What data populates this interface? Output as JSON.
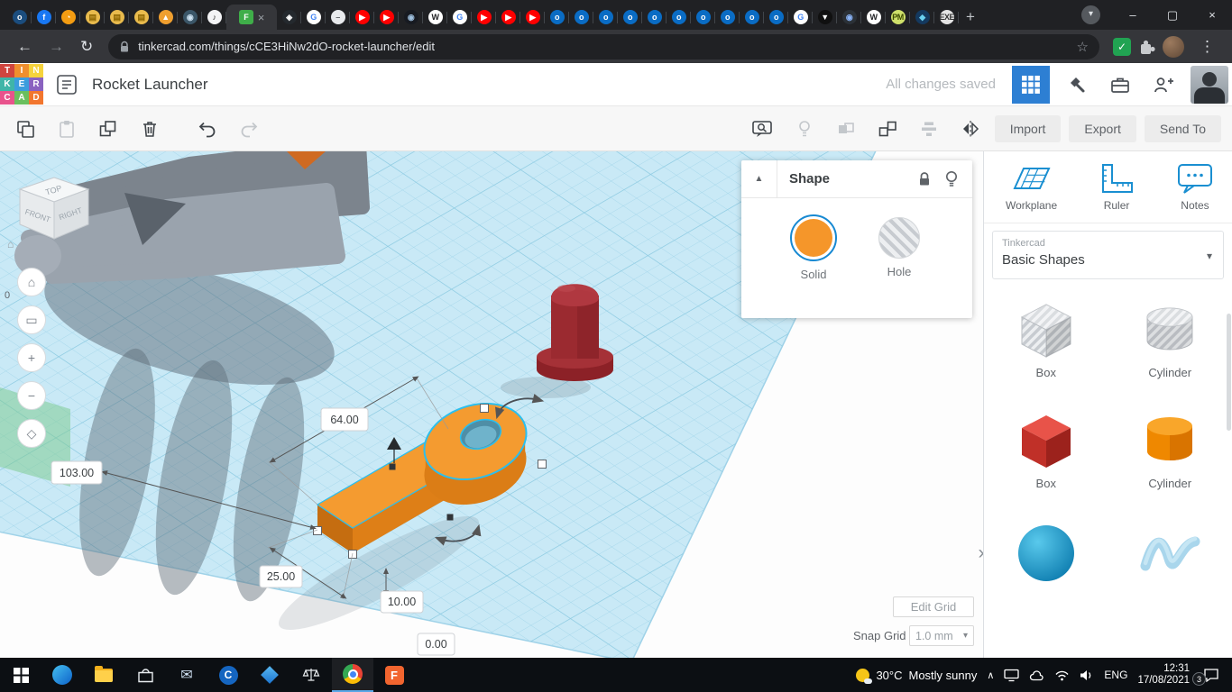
{
  "icons": {
    "close": "×",
    "minimize": "–",
    "maximize": "▢",
    "back": "←",
    "forward": "→",
    "reload": "↻",
    "star": "☆",
    "kebab": "⋮",
    "new_tab": "+",
    "profile_caret": "▾",
    "tray_chevron": "∧",
    "panel_collapse": "▲",
    "canvas_collapse": "›",
    "dropdown_caret": "▾",
    "home": "⌂",
    "fit_view": "▭",
    "zoom_in": "+",
    "zoom_out": "−",
    "ortho": "◇",
    "ext_check": "✓",
    "mail": "✉"
  },
  "browser": {
    "url": "tinkercad.com/things/cCE3HiNw2dO-rocket-launcher/edit",
    "tabs": [
      {
        "bg": "#1b4d7e",
        "fg": "#ffffff",
        "glyph": "o"
      },
      {
        "bg": "#1877f2",
        "fg": "#ffffff",
        "glyph": "f"
      },
      {
        "bg": "#f39c12",
        "fg": "#ffffff",
        "glyph": "◔"
      },
      {
        "bg": "#e9bb4d",
        "fg": "#8a6400",
        "glyph": "▤"
      },
      {
        "bg": "#e9bb4d",
        "fg": "#8a6400",
        "glyph": "▤"
      },
      {
        "bg": "#e9bb4d",
        "fg": "#8a6400",
        "glyph": "▤"
      },
      {
        "bg": "#ef9f2f",
        "fg": "#ffffff",
        "glyph": "▲"
      },
      {
        "bg": "#3b5668",
        "fg": "#cfe3f2",
        "glyph": "◉"
      },
      {
        "bg": "#f4f4f6",
        "fg": "#333333",
        "glyph": "♪"
      },
      {
        "bg": "#3fae49",
        "fg": "#ffffff",
        "glyph": "F",
        "active": true
      },
      {
        "bg": "#24292e",
        "fg": "#ffffff",
        "glyph": "◈"
      },
      {
        "bg": "#ffffff",
        "fg": "#4285f4",
        "glyph": "G"
      },
      {
        "bg": "#e8eaed",
        "fg": "#5f6368",
        "glyph": "–"
      },
      {
        "bg": "#ff0000",
        "fg": "#ffffff",
        "glyph": "▶"
      },
      {
        "bg": "#ff0000",
        "fg": "#ffffff",
        "glyph": "▶"
      },
      {
        "bg": "#171a21",
        "fg": "#9fc1e0",
        "glyph": "◉"
      },
      {
        "bg": "#ffffff",
        "fg": "#202124",
        "glyph": "W"
      },
      {
        "bg": "#ffffff",
        "fg": "#4285f4",
        "glyph": "G"
      },
      {
        "bg": "#ff0000",
        "fg": "#ffffff",
        "glyph": "▶"
      },
      {
        "bg": "#ff0000",
        "fg": "#ffffff",
        "glyph": "▶"
      },
      {
        "bg": "#ff0000",
        "fg": "#ffffff",
        "glyph": "▶"
      },
      {
        "bg": "#0a6cc4",
        "fg": "#ffffff",
        "glyph": "o"
      },
      {
        "bg": "#0a6cc4",
        "fg": "#ffffff",
        "glyph": "o"
      },
      {
        "bg": "#0a6cc4",
        "fg": "#ffffff",
        "glyph": "o"
      },
      {
        "bg": "#0a6cc4",
        "fg": "#ffffff",
        "glyph": "o"
      },
      {
        "bg": "#0a6cc4",
        "fg": "#ffffff",
        "glyph": "o"
      },
      {
        "bg": "#0a6cc4",
        "fg": "#ffffff",
        "glyph": "o"
      },
      {
        "bg": "#0a6cc4",
        "fg": "#ffffff",
        "glyph": "o"
      },
      {
        "bg": "#0a6cc4",
        "fg": "#ffffff",
        "glyph": "o"
      },
      {
        "bg": "#0a6cc4",
        "fg": "#ffffff",
        "glyph": "o"
      },
      {
        "bg": "#0a6cc4",
        "fg": "#ffffff",
        "glyph": "o"
      },
      {
        "bg": "#ffffff",
        "fg": "#4285f4",
        "glyph": "G"
      },
      {
        "bg": "#101010",
        "fg": "#ffffff",
        "glyph": "▼"
      },
      {
        "bg": "#2b3137",
        "fg": "#8ab4f8",
        "glyph": "◉"
      },
      {
        "bg": "#ffffff",
        "fg": "#202124",
        "glyph": "W"
      },
      {
        "bg": "#cfe06a",
        "fg": "#3c4a00",
        "glyph": "PM"
      },
      {
        "bg": "#14395f",
        "fg": "#6ad1f0",
        "glyph": "◆"
      },
      {
        "bg": "#e4e4e4",
        "fg": "#333333",
        "glyph": "EXE"
      }
    ]
  },
  "header": {
    "logo": [
      {
        "ch": "T",
        "bg": "#d0453e"
      },
      {
        "ch": "I",
        "bg": "#ef8f2e"
      },
      {
        "ch": "N",
        "bg": "#f6d33c"
      },
      {
        "ch": "K",
        "bg": "#3fb5a8"
      },
      {
        "ch": "E",
        "bg": "#3b9ddd"
      },
      {
        "ch": "R",
        "bg": "#8a62c0"
      },
      {
        "ch": "C",
        "bg": "#e8538c"
      },
      {
        "ch": "A",
        "bg": "#6abf5e"
      },
      {
        "ch": "D",
        "bg": "#f2762e"
      }
    ],
    "title": "Rocket Launcher",
    "saved_status": "All changes saved"
  },
  "toolbar": {
    "import": "Import",
    "export": "Export",
    "send_to": "Send To"
  },
  "viewport": {
    "viewcube": {
      "top": "TOP",
      "front": "FRONT",
      "right": "RIGHT"
    },
    "origin_label": "0",
    "dims": {
      "d64": "64.00",
      "d103": "103.00",
      "d25": "25.00",
      "d10": "10.00",
      "d0": "0.00"
    },
    "edit_grid": "Edit Grid",
    "snap_grid_label": "Snap Grid",
    "snap_grid_value": "1.0 mm"
  },
  "shape_panel": {
    "title": "Shape",
    "solid_label": "Solid",
    "hole_label": "Hole"
  },
  "sidebar": {
    "tools": [
      {
        "label": "Workplane"
      },
      {
        "label": "Ruler"
      },
      {
        "label": "Notes"
      }
    ],
    "library_group": "Tinkercad",
    "library_name": "Basic Shapes",
    "shapes": [
      {
        "label": "Box"
      },
      {
        "label": "Cylinder"
      },
      {
        "label": "Box"
      },
      {
        "label": "Cylinder"
      },
      {
        "label": ""
      },
      {
        "label": ""
      }
    ]
  },
  "taskbar": {
    "temp": "30°C",
    "weather": "Mostly sunny",
    "lang": "ENG",
    "time": "12:31",
    "date": "17/08/2021",
    "badge": "3",
    "c_app_glyph": "C",
    "tinkercad_glyph": "F"
  }
}
